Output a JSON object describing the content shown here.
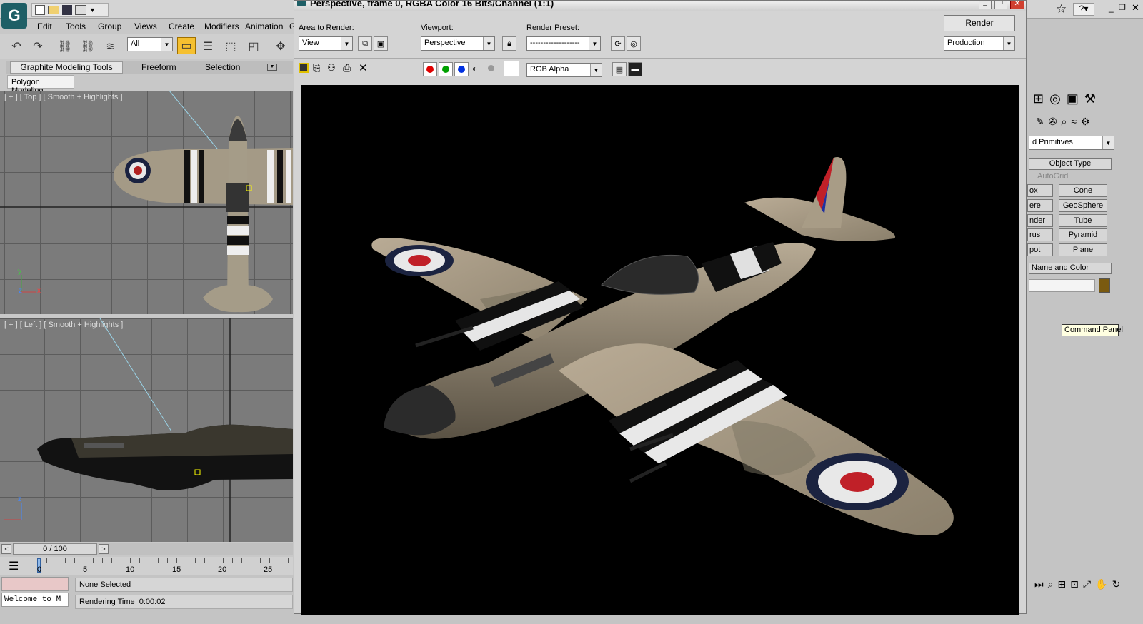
{
  "menu": [
    "Edit",
    "Tools",
    "Group",
    "Views",
    "Create",
    "Modifiers",
    "Animation",
    "Gr"
  ],
  "selection_filter": "All",
  "ribbon_tabs": [
    "Graphite Modeling Tools",
    "Freeform",
    "Selection"
  ],
  "ribbon_subtab": "Polygon Modeling",
  "viewport_top_label": "[ + ] [ Top ] [ Smooth + Highlights ]",
  "viewport_left_label": "[ + ] [ Left ] [ Smooth + Highlights ]",
  "axis": {
    "y": "y",
    "x": "x",
    "z": "z"
  },
  "timeline": {
    "position": "0 / 100",
    "ticks": [
      "0",
      "5",
      "10",
      "15",
      "20",
      "25"
    ]
  },
  "status": {
    "selection": "None Selected",
    "render_time": "Rendering Time  0:00:02",
    "welcome": "Welcome to M"
  },
  "render_window": {
    "title": "Perspective, frame 0, RGBA Color 16 Bits/Channel (1:1)",
    "area_label": "Area to Render:",
    "area_value": "View",
    "viewport_label": "Viewport:",
    "viewport_value": "Perspective",
    "preset_label": "Render Preset:",
    "preset_value": "-------------------",
    "render_button": "Render",
    "mode_value": "Production",
    "channel_value": "RGB Alpha",
    "colors": {
      "red": "#e00000",
      "green": "#00a000",
      "blue": "#0030e0"
    }
  },
  "command_panel": {
    "category": "d Primitives",
    "object_type": "Object Type",
    "autogrid": "AutoGrid",
    "left_buttons": [
      "ox",
      "ere",
      "nder",
      "rus",
      "pot"
    ],
    "right_buttons": [
      "Cone",
      "GeoSphere",
      "Tube",
      "Pyramid",
      "Plane"
    ],
    "name_color": "Name and Color",
    "swatch": "#7a5a10",
    "tooltip": "Command Panel"
  }
}
